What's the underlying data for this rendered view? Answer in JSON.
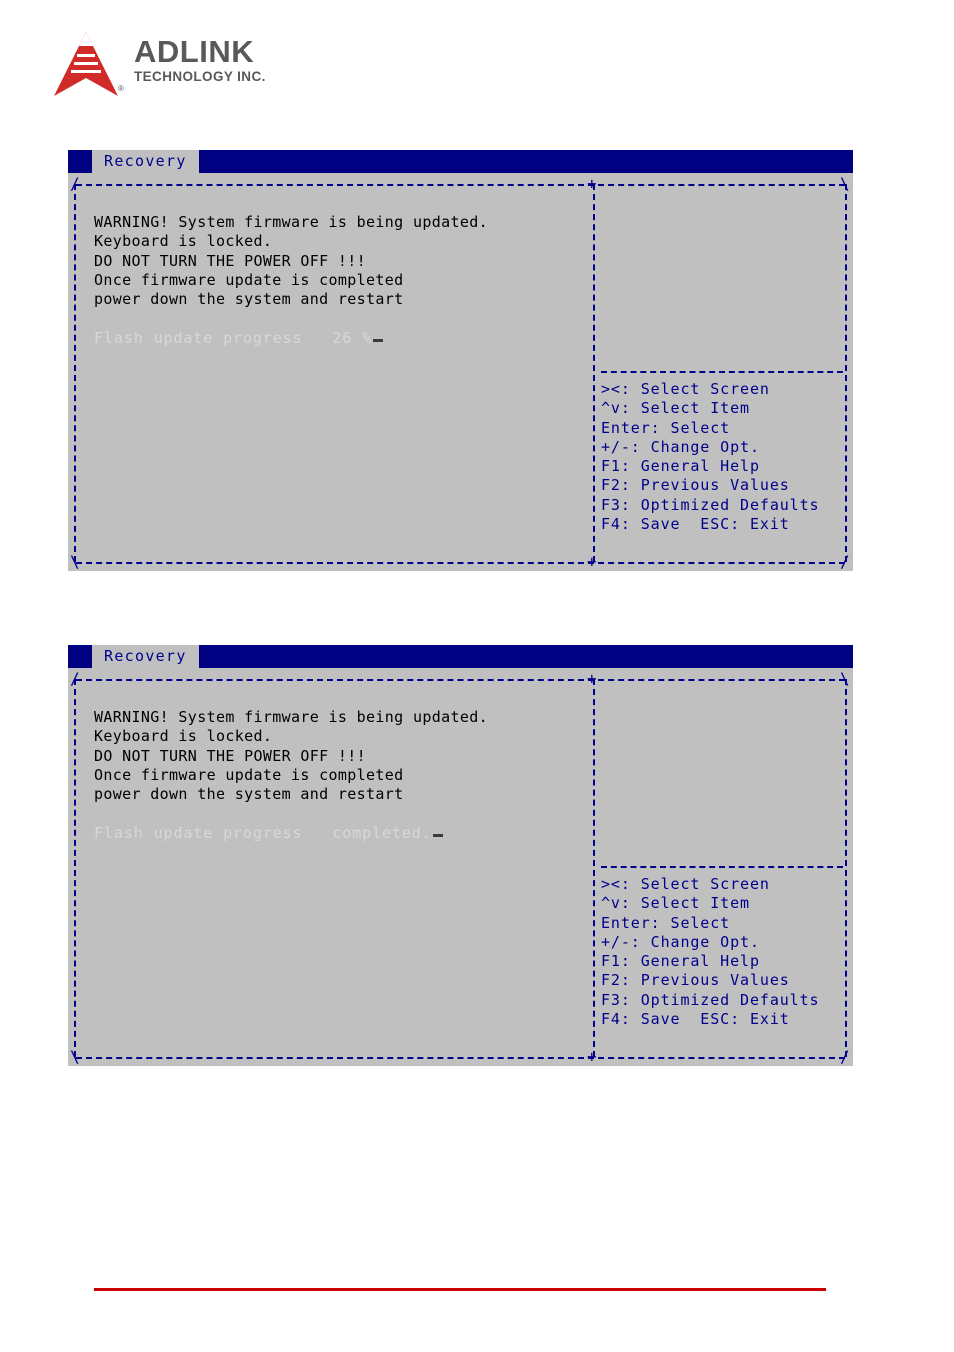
{
  "brand": {
    "name": "ADLINK",
    "tagline": "TECHNOLOGY INC.",
    "registered_mark": "®",
    "logo_red": "#d12b29",
    "logo_gray": "#58595b",
    "logo_icon": "adlink-triangle-logo"
  },
  "colors": {
    "bios_background": "#c0c0c0",
    "bios_titlebar": "#000083",
    "bios_border": "#00008b",
    "bios_text": "#000000",
    "bios_dim_text": "#d8d8d8",
    "footer_rule": "#cc0000"
  },
  "screens": [
    {
      "id": "recovery-progress",
      "tab_label": "Recovery",
      "warning_lines": [
        "WARNING! System firmware is being updated.",
        "Keyboard is locked.",
        "DO NOT TURN THE POWER OFF !!!",
        "Once firmware update is completed",
        "power down the system and restart"
      ],
      "progress_label": "Flash update progress",
      "progress_value": "26 %",
      "help_lines": [
        "><: Select Screen",
        "^v: Select Item",
        "Enter: Select",
        "+/-: Change Opt.",
        "F1: General Help",
        "F2: Previous Values",
        "F3: Optimized Defaults",
        "F4: Save  ESC: Exit"
      ],
      "frame": {
        "corner_top_left": "/",
        "corner_top_right": "\\",
        "corner_bottom_left": "\\",
        "corner_bottom_right": "/",
        "junction_top": "+",
        "junction_bottom": "+"
      }
    },
    {
      "id": "recovery-completed",
      "tab_label": "Recovery",
      "warning_lines": [
        "WARNING! System firmware is being updated.",
        "Keyboard is locked.",
        "DO NOT TURN THE POWER OFF !!!",
        "Once firmware update is completed",
        "power down the system and restart"
      ],
      "progress_label": "Flash update progress",
      "progress_value": "completed.",
      "help_lines": [
        "><: Select Screen",
        "^v: Select Item",
        "Enter: Select",
        "+/-: Change Opt.",
        "F1: General Help",
        "F2: Previous Values",
        "F3: Optimized Defaults",
        "F4: Save  ESC: Exit"
      ],
      "frame": {
        "corner_top_left": "/",
        "corner_top_right": "\\",
        "corner_bottom_left": "\\",
        "corner_bottom_right": "/",
        "junction_top": "+",
        "junction_bottom": "+"
      }
    }
  ]
}
